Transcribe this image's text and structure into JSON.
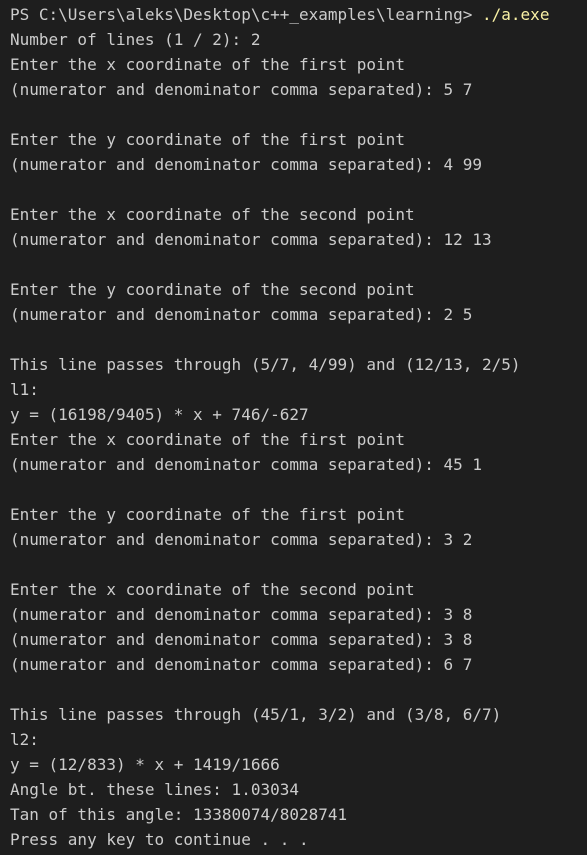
{
  "terminal": {
    "prompt": "PS C:\\Users\\aleks\\Desktop\\c++_examples\\learning> ",
    "command": "./a.exe",
    "lines": [
      "Number of lines (1 / 2): 2",
      "Enter the x coordinate of the first point",
      "(numerator and denominator comma separated): 5 7",
      "",
      "Enter the y coordinate of the first point",
      "(numerator and denominator comma separated): 4 99",
      "",
      "Enter the x coordinate of the second point",
      "(numerator and denominator comma separated): 12 13",
      "",
      "Enter the y coordinate of the second point",
      "(numerator and denominator comma separated): 2 5",
      "",
      "This line passes through (5/7, 4/99) and (12/13, 2/5)",
      "l1:",
      "y = (16198/9405) * x + 746/-627",
      "Enter the x coordinate of the first point",
      "(numerator and denominator comma separated): 45 1",
      "",
      "Enter the y coordinate of the first point",
      "(numerator and denominator comma separated): 3 2",
      "",
      "Enter the x coordinate of the second point",
      "(numerator and denominator comma separated): 3 8",
      "(numerator and denominator comma separated): 3 8",
      "(numerator and denominator comma separated): 6 7",
      "",
      "This line passes through (45/1, 3/2) and (3/8, 6/7)",
      "l2:",
      "y = (12/833) * x + 1419/1666",
      "Angle bt. these lines: 1.03034",
      "Tan of this angle: 13380074/8028741",
      "Press any key to continue . . ."
    ],
    "colors": {
      "background": "#1e1e1e",
      "text": "#cccccc",
      "command": "#f9f1a5"
    }
  }
}
